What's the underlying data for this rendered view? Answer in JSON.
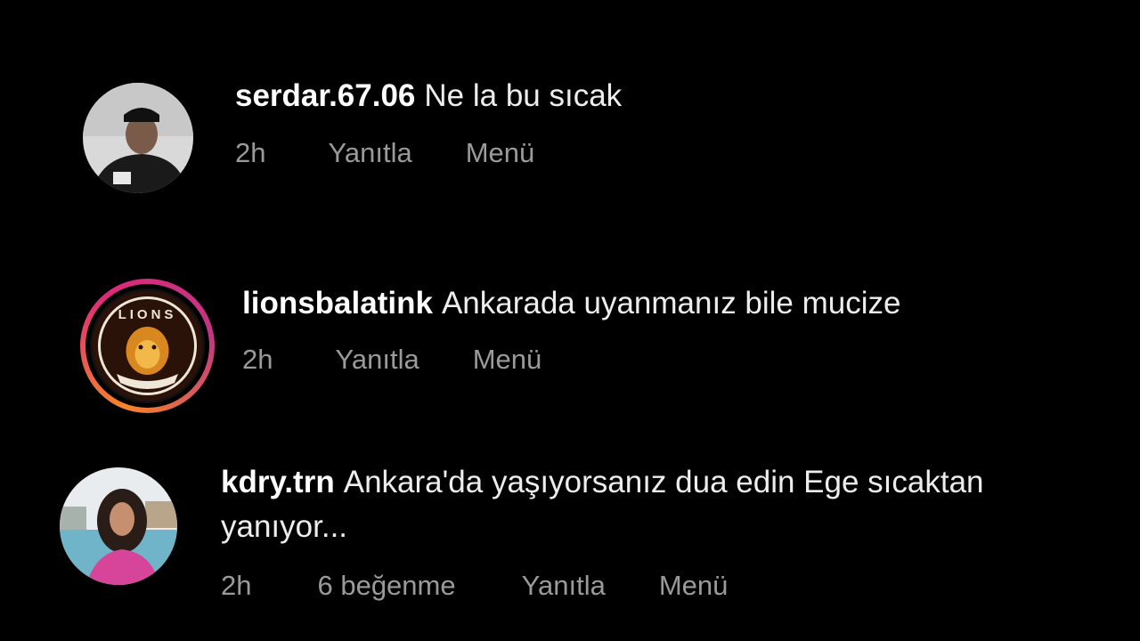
{
  "comments": [
    {
      "username": "serdar.67.06",
      "text": "Ne la bu sıcak",
      "time": "2h",
      "reply_label": "Yanıtla",
      "menu_label": "Menü"
    },
    {
      "username": "lionsbalatink",
      "text": "Ankarada uyanmanız bile mucize",
      "time": "2h",
      "reply_label": "Yanıtla",
      "menu_label": "Menü",
      "has_story_ring": true,
      "avatar_text": "LIONS"
    },
    {
      "username": "kdry.trn",
      "text_line1": "Ankara'da yaşıyorsanız dua edin Ege sıcaktan",
      "text_line2": "yanıyor...",
      "time": "2h",
      "likes": "6 beğenme",
      "reply_label": "Yanıtla",
      "menu_label": "Menü"
    }
  ],
  "colors": {
    "background": "#000000",
    "meta_text": "#9a9a9a",
    "story_ring": [
      "#f58529",
      "#dd2a7b",
      "#c13584"
    ]
  }
}
